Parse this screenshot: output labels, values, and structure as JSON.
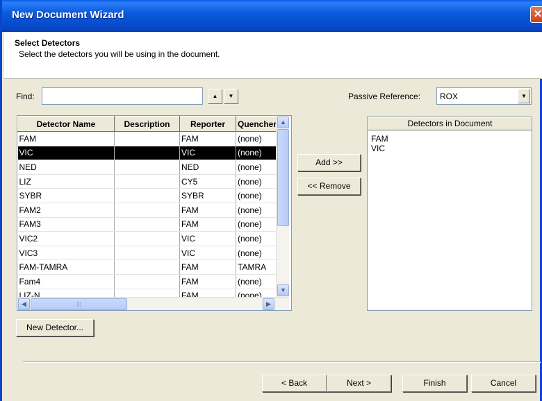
{
  "window": {
    "title": "New Document Wizard",
    "close_glyph": "✕"
  },
  "header": {
    "title": "Select Detectors",
    "subtitle": "Select the detectors you will be using in the document."
  },
  "find": {
    "label": "Find:",
    "value": "",
    "up_glyph": "▲",
    "down_glyph": "▼"
  },
  "passive_reference": {
    "label": "Passive Reference:",
    "value": "ROX",
    "dropdown_glyph": "▼"
  },
  "detector_table": {
    "columns": [
      "Detector Name",
      "Description",
      "Reporter",
      "Quencher"
    ],
    "rows": [
      {
        "name": "FAM",
        "description": "",
        "reporter": "FAM",
        "quencher": "(none)",
        "selected": false
      },
      {
        "name": "VIC",
        "description": "",
        "reporter": "VIC",
        "quencher": "(none)",
        "selected": true
      },
      {
        "name": "NED",
        "description": "",
        "reporter": "NED",
        "quencher": "(none)",
        "selected": false
      },
      {
        "name": "LIZ",
        "description": "",
        "reporter": "CY5",
        "quencher": "(none)",
        "selected": false
      },
      {
        "name": "SYBR",
        "description": "",
        "reporter": "SYBR",
        "quencher": "(none)",
        "selected": false
      },
      {
        "name": "FAM2",
        "description": "",
        "reporter": "FAM",
        "quencher": "(none)",
        "selected": false
      },
      {
        "name": "FAM3",
        "description": "",
        "reporter": "FAM",
        "quencher": "(none)",
        "selected": false
      },
      {
        "name": "VIC2",
        "description": "",
        "reporter": "VIC",
        "quencher": "(none)",
        "selected": false
      },
      {
        "name": "VIC3",
        "description": "",
        "reporter": "VIC",
        "quencher": "(none)",
        "selected": false
      },
      {
        "name": "FAM-TAMRA",
        "description": "",
        "reporter": "FAM",
        "quencher": "TAMRA",
        "selected": false
      },
      {
        "name": "Fam4",
        "description": "",
        "reporter": "FAM",
        "quencher": "(none)",
        "selected": false
      },
      {
        "name": "LIZ-N",
        "description": "",
        "reporter": "FAM",
        "quencher": "(none)",
        "selected": false
      }
    ],
    "scroll_up_glyph": "▲",
    "scroll_down_glyph": "▼",
    "scroll_left_glyph": "◀",
    "scroll_right_glyph": "▶",
    "thumb_grip": "|||"
  },
  "buttons": {
    "add": "Add >>",
    "remove": "<< Remove",
    "new_detector": "New Detector...",
    "back": "< Back",
    "next": "Next >",
    "finish": "Finish",
    "cancel": "Cancel"
  },
  "document_detectors": {
    "header": "Detectors in Document",
    "items": [
      "FAM",
      "VIC"
    ]
  },
  "colors": {
    "titlebar": "#0b5bdc",
    "selection": "#000000",
    "dialog_background": "#ece9d8"
  }
}
